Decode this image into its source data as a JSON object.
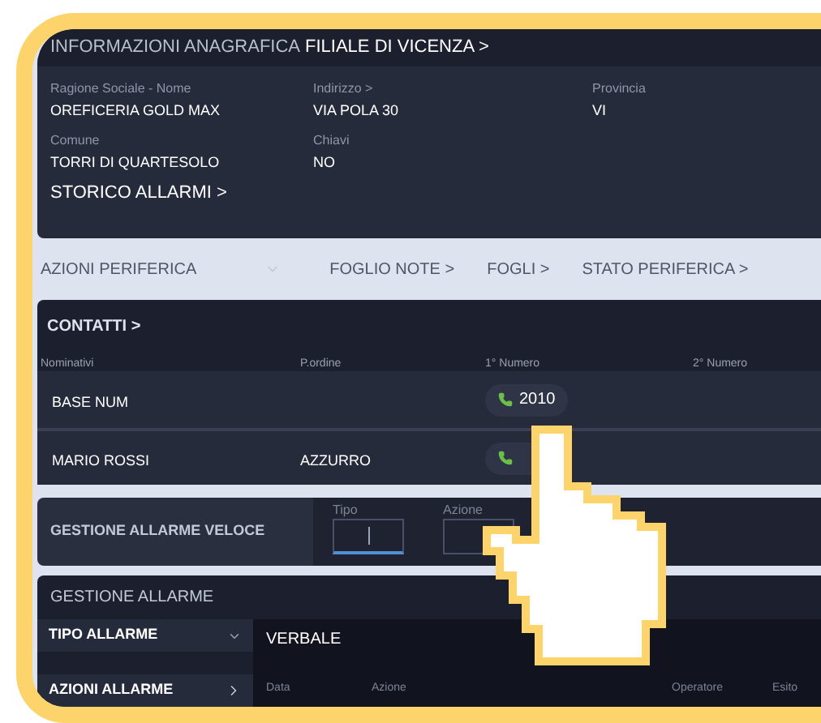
{
  "info": {
    "title_prefix": "INFORMAZIONI ANAGRAFICA",
    "title": "FILIALE DI VICENZA >",
    "fields": [
      {
        "label": "Ragione Sociale - Nome",
        "value": "OREFICERIA GOLD MAX"
      },
      {
        "label": "Indirizzo >",
        "value": "VIA POLA 30"
      },
      {
        "label": "Provincia",
        "value": "VI"
      },
      {
        "label": "Comune",
        "value": "TORRI DI QUARTESOLO"
      },
      {
        "label": "Chiavi",
        "value": "NO"
      }
    ],
    "link": "STORICO ALLARMI >"
  },
  "tabs": [
    {
      "label": "AZIONI PERIFERICA",
      "kind": "dropdown"
    },
    {
      "label": "FOGLIO NOTE >",
      "kind": "link"
    },
    {
      "label": "FOGLI >",
      "kind": "link"
    },
    {
      "label": "STATO PERIFERICA >",
      "kind": "link"
    }
  ],
  "contacts": {
    "title": "CONTATTI >",
    "columns": [
      "Nominativi",
      "P.ordine",
      "1° Numero",
      "2° Numero"
    ],
    "rows": [
      {
        "name": "BASE NUM",
        "number": "2010"
      },
      {
        "name": "MARIO ROSSI",
        "order": "AZZURRO"
      }
    ]
  },
  "quick": {
    "title": "GESTIONE ALLARME VELOCE",
    "fields": [
      {
        "label": "Tipo",
        "focused": true
      },
      {
        "label": "Azione",
        "focused": false
      }
    ]
  },
  "alarms": {
    "title": "GESTIONE ALLARME",
    "menu": [
      {
        "label": "TIPO ALLARME",
        "kind": "dropdown"
      },
      {
        "label": "AZIONI ALLARME",
        "kind": "link"
      }
    ],
    "log_title": "VERBALE",
    "columns": [
      "Data",
      "Azione",
      "Operatore",
      "Esito"
    ]
  }
}
